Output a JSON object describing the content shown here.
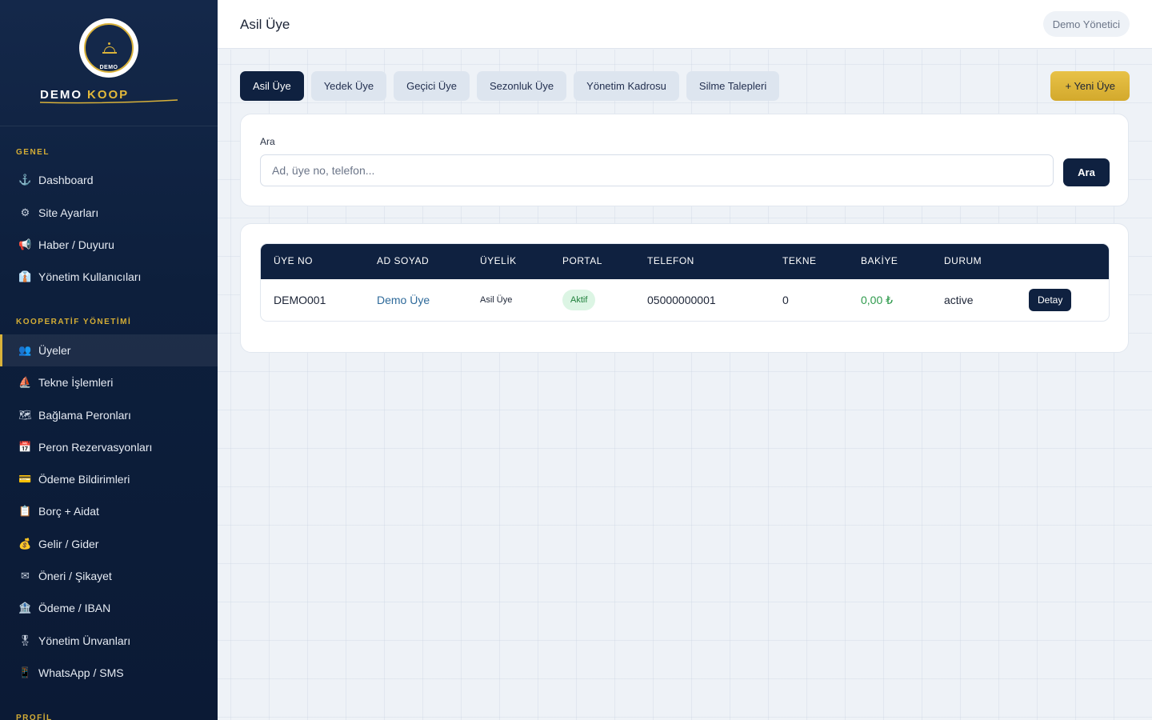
{
  "brand": {
    "logo_caption": "DEMO",
    "name_primary": "DEMO",
    "name_accent": "KOOP"
  },
  "sidebar": {
    "sections": [
      {
        "label": "GENEL"
      },
      {
        "label": "KOOPERATİF YÖNETİMİ"
      },
      {
        "label": "PROFİL"
      }
    ],
    "items": [
      {
        "label": "Dashboard",
        "icon": "anchor-icon",
        "glyph": "⚓"
      },
      {
        "label": "Site Ayarları",
        "icon": "gear-icon",
        "glyph": "⚙"
      },
      {
        "label": "Haber / Duyuru",
        "icon": "megaphone-icon",
        "glyph": "📢"
      },
      {
        "label": "Yönetim Kullanıcıları",
        "icon": "admin-icon",
        "glyph": "👔"
      },
      {
        "label": "Üyeler",
        "icon": "users-icon",
        "glyph": "👥",
        "active": true
      },
      {
        "label": "Tekne İşlemleri",
        "icon": "sailboat-icon",
        "glyph": "⛵"
      },
      {
        "label": "Bağlama Peronları",
        "icon": "map-icon",
        "glyph": "🗺"
      },
      {
        "label": "Peron Rezervasyonları",
        "icon": "calendar-icon",
        "glyph": "📅"
      },
      {
        "label": "Ödeme Bildirimleri",
        "icon": "credit-card-icon",
        "glyph": "💳"
      },
      {
        "label": "Borç + Aidat",
        "icon": "clipboard-icon",
        "glyph": "📋"
      },
      {
        "label": "Gelir / Gider",
        "icon": "money-bag-icon",
        "glyph": "💰"
      },
      {
        "label": "Öneri / Şikayet",
        "icon": "envelope-icon",
        "glyph": "✉"
      },
      {
        "label": "Ödeme / IBAN",
        "icon": "bank-icon",
        "glyph": "🏦"
      },
      {
        "label": "Yönetim Ünvanları",
        "icon": "medal-icon",
        "glyph": "🎖"
      },
      {
        "label": "WhatsApp / SMS",
        "icon": "phone-icon",
        "glyph": "📱"
      }
    ]
  },
  "header": {
    "title": "Asil Üye",
    "user": "Demo Yönetici"
  },
  "tabs": [
    {
      "label": "Asil Üye",
      "active": true
    },
    {
      "label": "Yedek Üye"
    },
    {
      "label": "Geçici Üye"
    },
    {
      "label": "Sezonluk Üye"
    },
    {
      "label": "Yönetim Kadrosu"
    },
    {
      "label": "Silme Talepleri"
    }
  ],
  "new_button": "+ Yeni Üye",
  "search": {
    "label": "Ara",
    "placeholder": "Ad, üye no, telefon...",
    "value": "",
    "button": "Ara"
  },
  "table": {
    "columns": [
      "ÜYE NO",
      "AD SOYAD",
      "ÜYELİK",
      "PORTAL",
      "TELEFON",
      "TEKNE",
      "BAKİYE",
      "DURUM"
    ],
    "rows": [
      {
        "uye_no": "DEMO001",
        "ad_soyad": "Demo Üye",
        "uyelik": "Asil Üye",
        "portal": "Aktif",
        "telefon": "05000000001",
        "tekne": "0",
        "bakiye": "0,00 ₺",
        "durum": "active",
        "action": "Detay"
      }
    ]
  },
  "colors": {
    "sidebar_bg": "#0d1f3c",
    "accent_gold": "#d9b23a",
    "primary_navy": "#0f2140",
    "success_green": "#2e9a4c",
    "link_blue": "#2e6a9a"
  }
}
